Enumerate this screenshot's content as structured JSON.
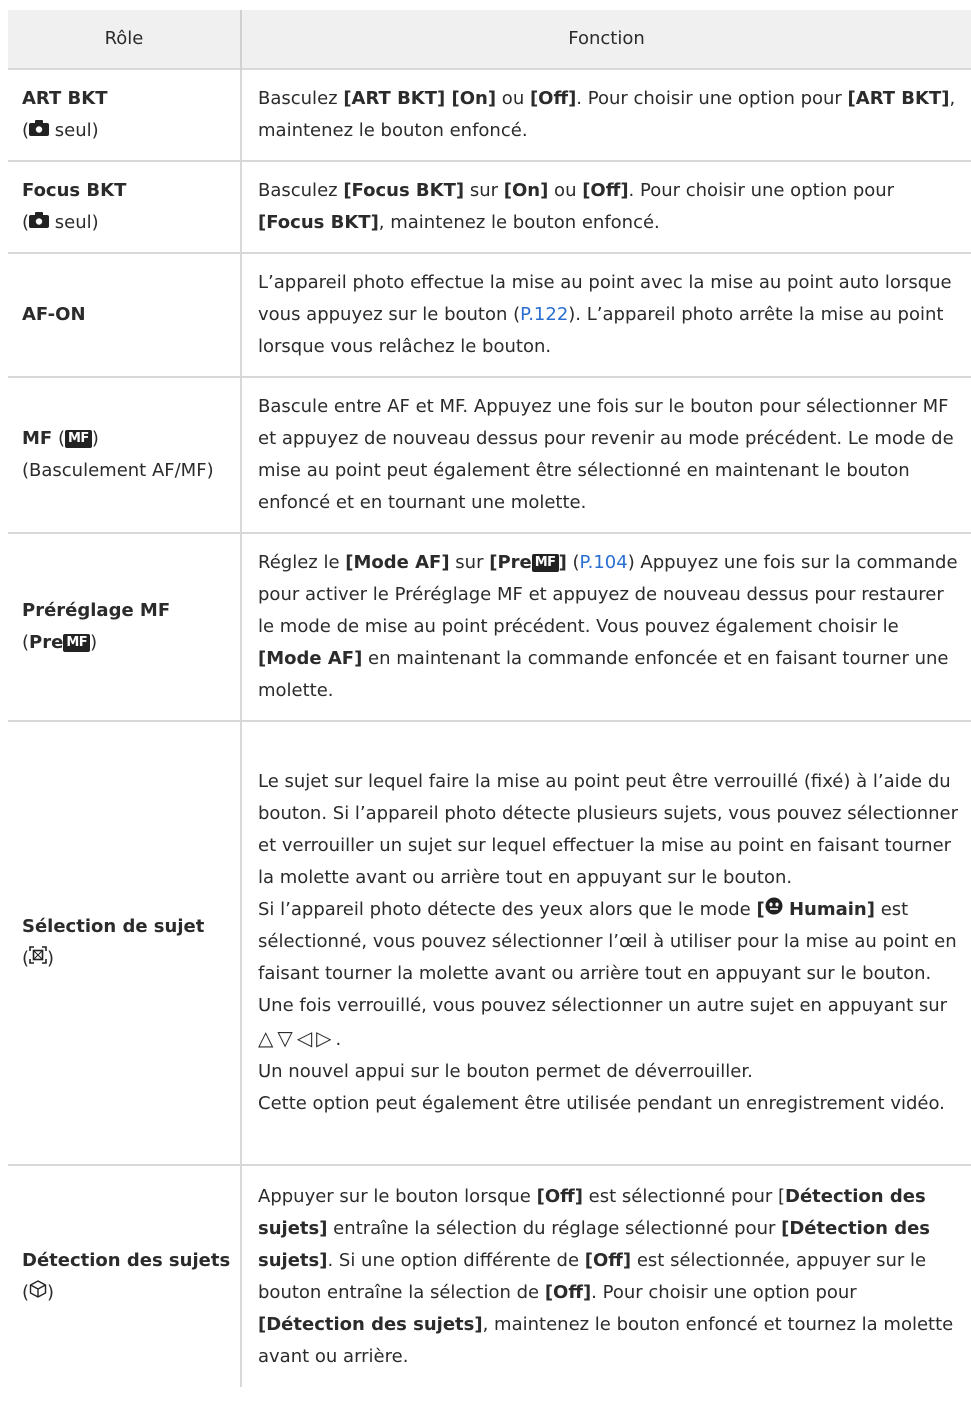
{
  "header": {
    "role": "Rôle",
    "function": "Fonction"
  },
  "common": {
    "seul": "seul",
    "mf_badge": "MF",
    "pre": "Pre",
    "open_paren": "(",
    "close_paren": ")",
    "close_bracket": "]",
    "icons": {
      "camera": "camera-icon",
      "mf_badge": "mf-badge-icon",
      "subject_select": "subject-select-icon",
      "subject_detect": "subject-detect-icon",
      "face": "face-icon",
      "arrows": "△▽◁▷"
    }
  },
  "rows": [
    {
      "role_name": "ART BKT",
      "function": {
        "t1": "Basculez ",
        "b1": "[ART BKT] [On]",
        "t2": " ou ",
        "b2": "[Off]",
        "t3": ". Pour choisir une option pour ",
        "b3": "[ART BKT]",
        "t4": ", maintenez le bouton enfoncé."
      }
    },
    {
      "role_name": "Focus BKT",
      "function": {
        "t1": "Basculez ",
        "b1": "[Focus BKT]",
        "t2": " sur ",
        "b2": "[On]",
        "t3": " ou ",
        "b3": "[Off]",
        "t4": ". Pour choisir une option pour ",
        "b4": "[Focus BKT]",
        "t5": ", maintenez le bouton enfoncé."
      }
    },
    {
      "role_name": "AF-ON",
      "function": {
        "t1": "L’appareil photo effectue la mise au point avec la mise au point auto lorsque vous appuyez sur le bouton (",
        "link": "P.122",
        "t2": "). L’appareil photo arrête la mise au point lorsque vous relâchez le bouton."
      }
    },
    {
      "role_name": "MF",
      "role_sub": "(Basculement AF/MF)",
      "function": {
        "t1": "Bascule entre AF et MF. Appuyez une fois sur le bouton pour sélectionner MF et appuyez de nouveau dessus pour revenir au mode précédent. Le mode de mise au point peut également être sélectionné en maintenant le bouton enfoncé et en tournant une molette."
      }
    },
    {
      "role_name": "Préréglage MF",
      "function": {
        "t1": "Réglez le ",
        "b1": "[Mode AF]",
        "t2": " sur ",
        "b2": "[Pre",
        "t3": " (",
        "link": "P.104",
        "t4": ") Appuyez une fois sur la commande pour activer le Préréglage MF et appuyez de nouveau dessus pour restaurer le mode de mise au point précédent. Vous pouvez également choisir le ",
        "b3": "[Mode AF]",
        "t5": " en maintenant la commande enfoncée et en faisant tourner une molette."
      }
    },
    {
      "role_name": "Sélection de sujet",
      "function": {
        "p1": "Le sujet sur lequel faire la mise au point peut être verrouillé (fixé) à l’aide du bouton. Si l’appareil photo détecte plusieurs sujets, vous pouvez sélectionner et verrouiller un sujet sur lequel effectuer la mise au point en faisant tourner la molette avant ou arrière tout en appuyant sur le bouton.",
        "p2a": "Si l’appareil photo détecte des yeux alors que le mode ",
        "p2b_open": "[",
        "p2b_label": " Humain]",
        "p2c": " est sélectionné, vous pouvez sélectionner l’œil à utiliser pour la mise au point en faisant tourner la molette avant ou arrière tout en appuyant sur le bouton.",
        "p3a": "Une fois verrouillé, vous pouvez sélectionner un autre sujet en appuyant sur ",
        "p3b": ".",
        "p4": "Un nouvel appui sur le bouton permet de déverrouiller.",
        "p5": "Cette option peut également être utilisée pendant un enregistrement vidéo."
      }
    },
    {
      "role_name": "Détection des sujets",
      "function": {
        "t1": "Appuyer sur le bouton lorsque ",
        "b1": "[Off]",
        "t2": " est sélectionné pour [",
        "b2": "Détection des sujets]",
        "t3": " entraîne la sélection du réglage sélectionné pour ",
        "b3": "[Détection des sujets]",
        "t4": ". Si une option différente de ",
        "b4": "[Off]",
        "t5": " est sélectionnée, appuyer sur le bouton entraîne la sélection de ",
        "b5": "[Off]",
        "t6": ". Pour choisir une option pour ",
        "b6": "[Détection des sujets]",
        "t7": ", maintenez le bouton enfoncé et tournez la molette avant ou arrière."
      }
    }
  ]
}
